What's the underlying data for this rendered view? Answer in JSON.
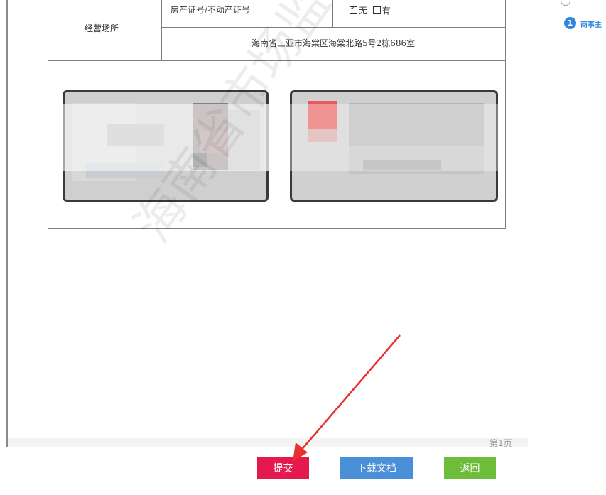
{
  "document": {
    "table": {
      "row_label": "经营场所",
      "cert_label": "房产证号/不动产证号",
      "cert_options": [
        {
          "label": "无",
          "checked": true
        },
        {
          "label": "有",
          "checked": false
        }
      ],
      "address": "海南省三亚市海棠区海棠北路5号2栋686室"
    },
    "watermark": "海南省市场监督",
    "page_number": "第1页"
  },
  "steps": {
    "current_number": "1",
    "current_label": "商事主",
    "icon": "document-icon"
  },
  "buttons": {
    "submit": "提交",
    "download": "下载文档",
    "back": "返回"
  },
  "colors": {
    "submit": "#e6194f",
    "download": "#4a90d9",
    "back": "#6dbd3a",
    "arrow": "#e8302c",
    "step_accent": "#2e86de"
  }
}
